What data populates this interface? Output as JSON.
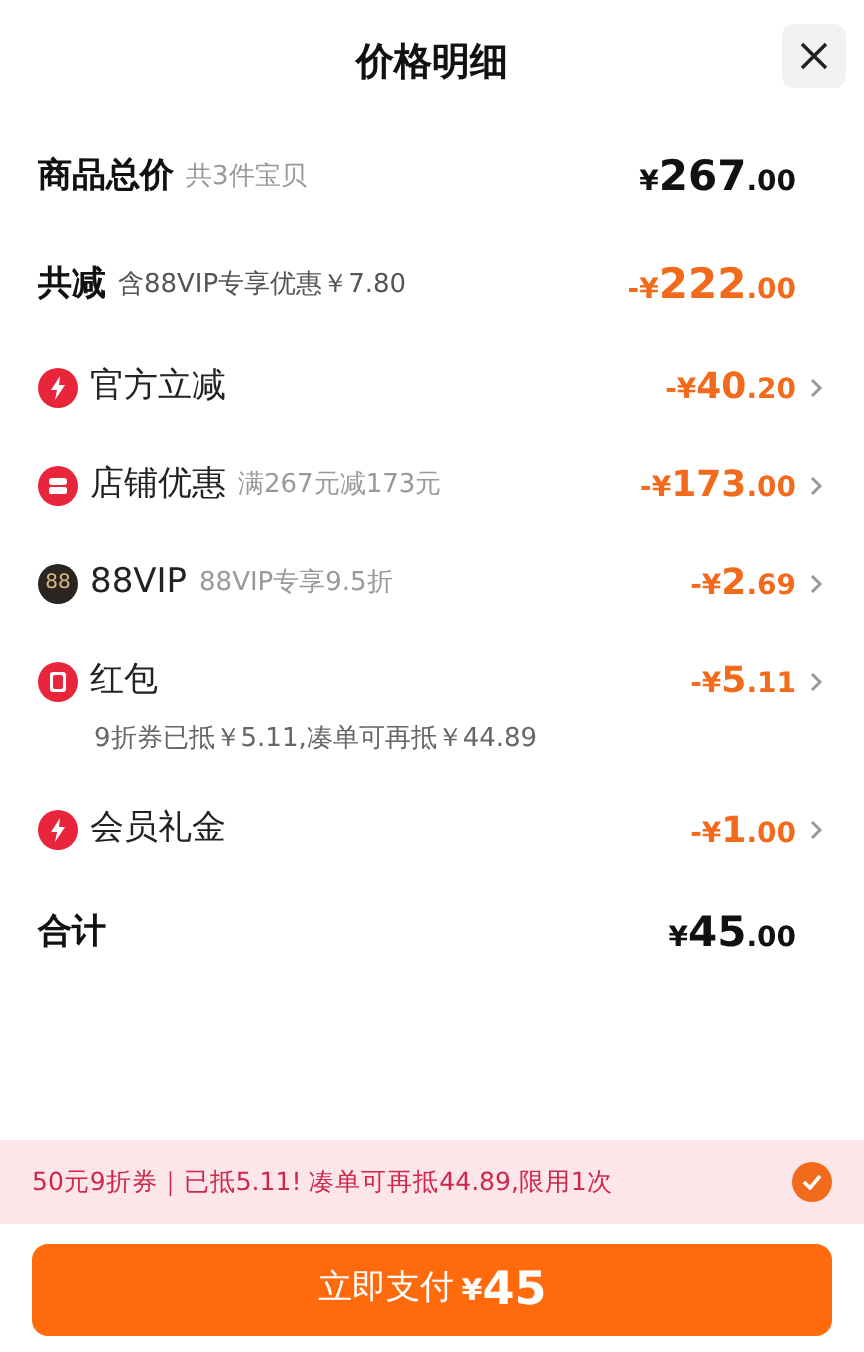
{
  "title": "价格明细",
  "rows": [
    {
      "kind": "summary",
      "label": "商品总价",
      "note": "共3件宝贝",
      "currency": "¥",
      "amount": "267",
      "cents": ".00",
      "chevron": false
    },
    {
      "kind": "discount-summary",
      "label": "共减",
      "note": "含88VIP专享优惠￥7.80",
      "currency": "-¥",
      "amount": "222",
      "cents": ".00",
      "chevron": false
    },
    {
      "kind": "lightning",
      "label": "官方立减",
      "currency": "-¥",
      "amount": "40",
      "cents": ".20",
      "chevron": true
    },
    {
      "kind": "store",
      "label": "店铺优惠",
      "note": "满267元减173元",
      "currency": "-¥",
      "amount": "173",
      "cents": ".00",
      "chevron": true
    },
    {
      "kind": "vip",
      "icon_text": "88",
      "label": "88VIP",
      "note": "88VIP专享9.5折",
      "currency": "-¥",
      "amount": "2",
      "cents": ".69",
      "chevron": true
    },
    {
      "kind": "packet",
      "label": "红包",
      "sub": "9折券已抵￥5.11,凑单可再抵￥44.89",
      "currency": "-¥",
      "amount": "5",
      "cents": ".11",
      "chevron": true
    },
    {
      "kind": "lightning",
      "label": "会员礼金",
      "currency": "-¥",
      "amount": "1",
      "cents": ".00",
      "chevron": true
    },
    {
      "kind": "summary",
      "label": "合计",
      "currency": "¥",
      "amount": "45",
      "cents": ".00",
      "chevron": false
    }
  ],
  "banner": {
    "text": "50元9折券｜已抵5.11! 凑单可再抵44.89,限用1次",
    "checked": true
  },
  "pay_button": {
    "label": "立即支付",
    "currency": "¥",
    "amount": "45"
  }
}
